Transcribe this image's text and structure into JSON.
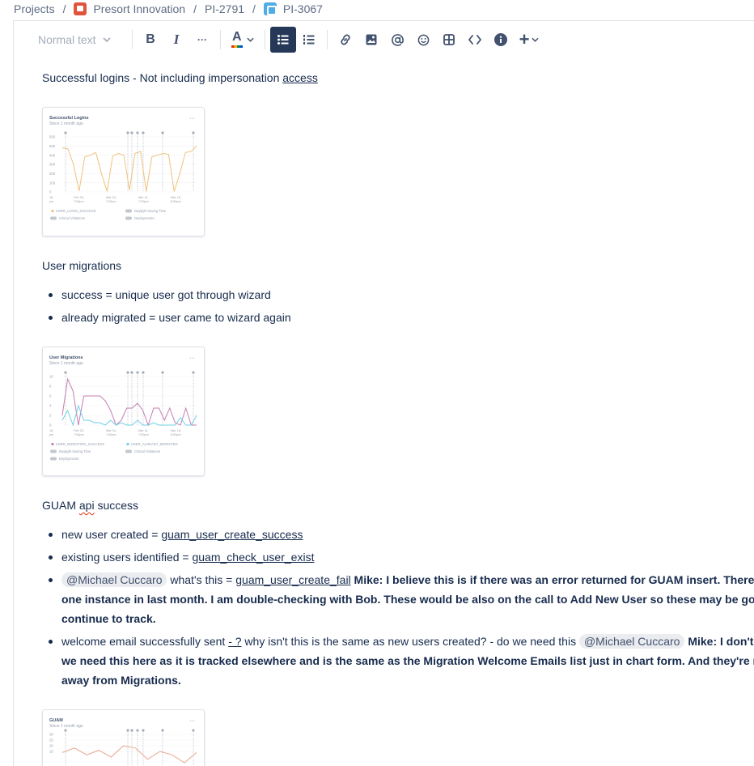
{
  "breadcrumb": {
    "items": [
      "Projects",
      "Presort Innovation",
      "PI-2791",
      "PI-3067"
    ],
    "separator": "/"
  },
  "toolbar": {
    "text_style": "Normal text",
    "bold": "B",
    "italic": "I",
    "more": "···",
    "color": "A",
    "insert": "+"
  },
  "content": {
    "p1_text": "Successful logins - Not including impersonation ",
    "p1_link": "access",
    "p2": "User migrations",
    "migration_bullets": [
      "success = unique user got through wizard",
      "already migrated = user came to wizard again"
    ],
    "p3_a": "GUAM ",
    "p3_b": "api",
    "p3_c": " success",
    "guam_bullets": {
      "b1_text": "new user created = ",
      "b1_code": "guam_user_create_success",
      "b2_text": "existing users identified = ",
      "b2_code": "guam_check_user_exist",
      "b3_mention": "@Michael Cuccaro",
      "b3_text": " what's this = ",
      "b3_code": "guam_user_create_fail",
      "b3_strong": " Mike: I believe this is if there was an error returned for GUAM insert. There is ju",
      "b3_line2": "one instance in last month. I am double-checking with Bob. These would be also on the call to Add New User so these may be good",
      "b3_line3": "continue to track.",
      "b4_text": "welcome email successfully sent ",
      "b4_link": " - ?",
      "b4_text2": " why isn't this is the same as new users created? - do we need this ",
      "b4_mention": "@Michael Cuccaro",
      "b4_strong": " Mike: I don't thir",
      "b4_line2": "we need this here as it is tracked elsewhere and is the same as the Migration Welcome Emails list just in chart form. And they're mov",
      "b4_line3": "away from Migrations."
    }
  },
  "chart_data": [
    {
      "type": "line",
      "title": "Successful Logins",
      "subtitle": "Since 1 month ago",
      "yticks": [
        "600",
        "500",
        "400",
        "300",
        "200",
        "100",
        "0"
      ],
      "ylim": [
        0,
        600
      ],
      "xticks": [
        "16,\npm",
        "Feb 25,\n7:00pm",
        "Mar 04,\n7:00pm",
        "Mar 11,\n7:00pm",
        "Mar 18,\n8:00pm"
      ],
      "series": [
        {
          "name": "USER_LOGIN_SUCCESS",
          "color": "#f0c27b",
          "values": [
            480,
            470,
            300,
            10,
            380,
            400,
            430,
            200,
            5,
            390,
            420,
            400,
            20,
            420,
            440,
            5,
            380,
            400,
            420,
            410,
            5,
            200,
            430,
            440,
            500
          ]
        }
      ],
      "legend": [
        "USER_LOGIN_SUCCESS",
        "Daylight Saving Time",
        "Critical Violations",
        "Deployments"
      ],
      "grid": true
    },
    {
      "type": "line",
      "title": "User Migrations",
      "subtitle": "Since 1 month ago",
      "yticks": [
        "10",
        "8",
        "6",
        "4",
        "2",
        "0"
      ],
      "ylim": [
        0,
        10
      ],
      "xticks": [
        "16,\npm",
        "Feb 25,\n7:00pm",
        "Mar 04,\n7:00pm",
        "Mar 11,\n7:00pm",
        "Mar 18,\n8:00pm"
      ],
      "series": [
        {
          "name": "USER_MIGRATION_SUCCESS",
          "color": "#c57fb0",
          "values": [
            2,
            9.5,
            7,
            0,
            6,
            6,
            6,
            6,
            5,
            3,
            0,
            1,
            3.5,
            3.5,
            4.5,
            3,
            0,
            3.5,
            3.5,
            1,
            3.5,
            0.5,
            0,
            3.5,
            0,
            0
          ]
        },
        {
          "name": "USER_ALREADY_MIGRATED",
          "color": "#6fd0e6",
          "values": [
            1,
            3,
            0,
            4,
            1,
            1,
            0.5,
            0.5,
            0,
            1,
            0,
            0.5,
            0,
            0,
            1,
            0,
            0,
            0.5,
            0,
            0,
            0,
            0,
            1.5,
            0,
            0,
            2
          ]
        }
      ],
      "legend": [
        "USER_MIGRATION_SUCCESS",
        "USER_ALREADY_MIGRATED",
        "Daylight Saving Time",
        "Critical Violations",
        "Deployments"
      ],
      "grid": true
    },
    {
      "type": "line",
      "title": "GUAM",
      "subtitle": "Since 1 month ago",
      "yticks": [
        "30",
        "25",
        "20",
        "15"
      ],
      "ylim": [
        0,
        30
      ],
      "series": [
        {
          "name": "",
          "color": "#e8a58c",
          "values": [
            14,
            18,
            12,
            16,
            10,
            20,
            18,
            8,
            15,
            12,
            5,
            14
          ]
        }
      ],
      "grid": true
    }
  ]
}
